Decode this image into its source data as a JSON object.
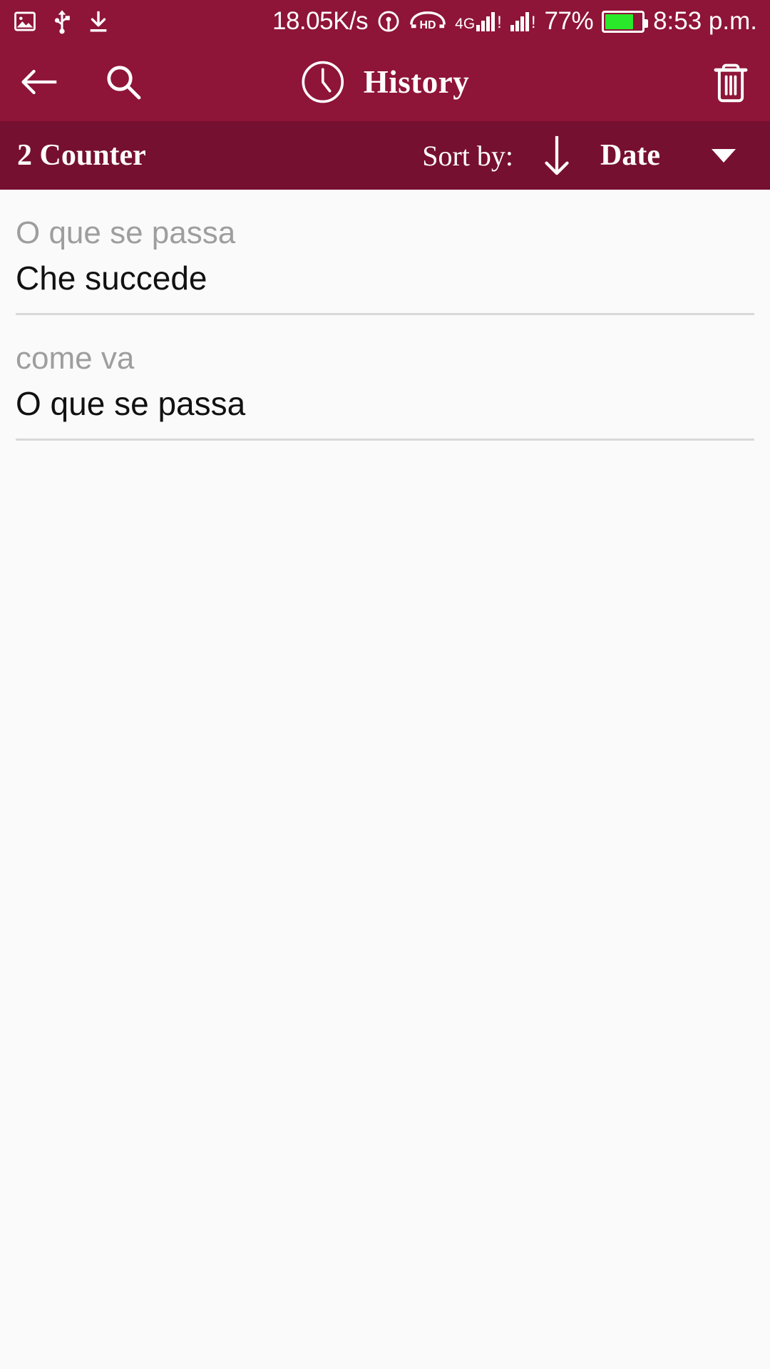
{
  "status_bar": {
    "icons_left": [
      "image-icon",
      "usb-icon",
      "download-icon"
    ],
    "network_speed": "18.05K/s",
    "hotspot_icon": "hotspot-icon",
    "volte_label": "HD",
    "network_type": "4G",
    "battery_percent": "77%",
    "battery_level": 77,
    "time": "8:53 p.m."
  },
  "app_bar": {
    "back_icon": "back-arrow-icon",
    "search_icon": "search-icon",
    "clock_icon": "clock-icon",
    "title": "History",
    "delete_icon": "trash-icon"
  },
  "sort_bar": {
    "counter": "2 Counter",
    "sort_label": "Sort by:",
    "sort_direction_icon": "arrow-down-icon",
    "sort_value": "Date",
    "dropdown_icon": "caret-down-icon"
  },
  "history": {
    "items": [
      {
        "source": "O que se passa",
        "translation": "Che succede"
      },
      {
        "source": "come va",
        "translation": "O que se passa"
      }
    ]
  },
  "colors": {
    "app_bar": "#8E1438",
    "sort_bar": "#761030",
    "background": "#fafafa",
    "source_text": "#9e9e9e",
    "translation_text": "#111111",
    "battery_fill": "#2ae82a"
  }
}
